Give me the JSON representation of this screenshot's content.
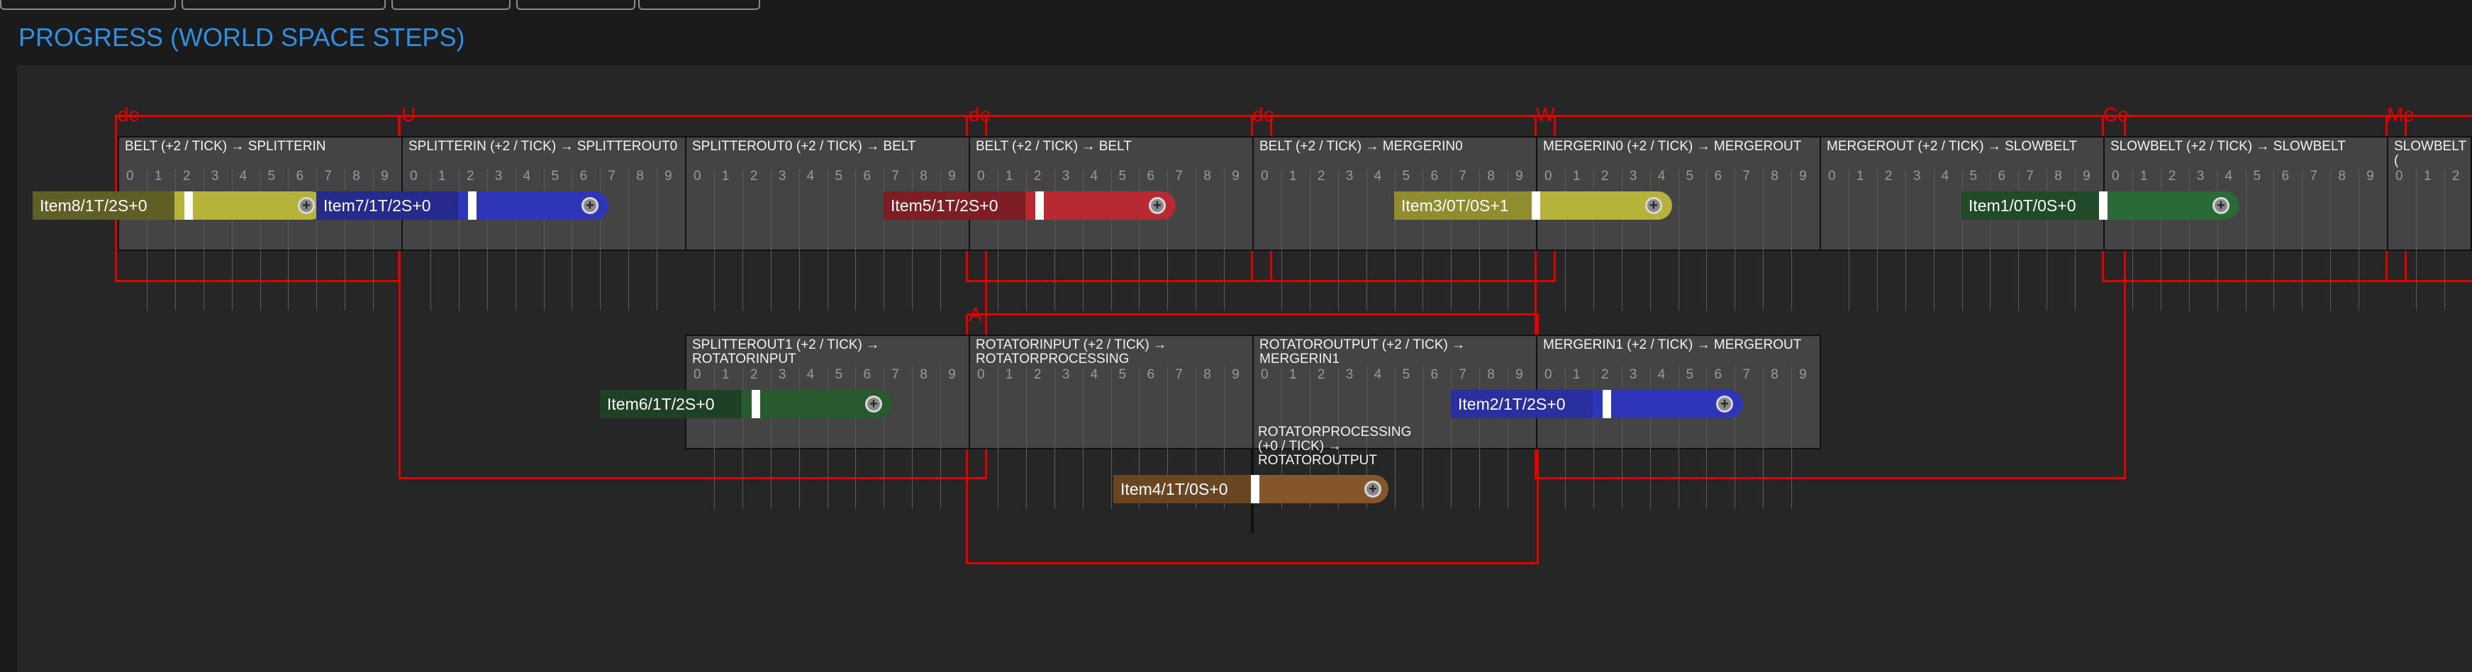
{
  "page": {
    "title": "PROGRESS (WORLD SPACE STEPS)"
  },
  "tick_labels": [
    "0",
    "1",
    "2",
    "3",
    "4",
    "5",
    "6",
    "7",
    "8",
    "9"
  ],
  "group_labels": {
    "g1": "de",
    "g2": "U",
    "g3": "de",
    "g4": "de",
    "g5": "W",
    "g6": "Ce",
    "g7": "Me",
    "g8": "A"
  },
  "segments": {
    "s1": "BELT (+2 / TICK) → SPLITTERIN",
    "s2": "SPLITTERIN (+2 / TICK) → SPLITTEROUT0",
    "s3": "SPLITTEROUT0 (+2 / TICK) → BELT",
    "s4": "BELT (+2 / TICK) → BELT",
    "s5": "BELT (+2 / TICK) → MERGERIN0",
    "s6": "MERGERIN0 (+2 / TICK) → MERGEROUT",
    "s7": "MERGEROUT (+2 / TICK) → SLOWBELT",
    "s8": "SLOWBELT (+2 / TICK) → SLOWBELT",
    "s9": "SLOWBELT (",
    "s10": "SPLITTEROUT1 (+2 / TICK) → ROTATORINPUT",
    "s11": "ROTATORINPUT (+2 / TICK) → ROTATORPROCESSING",
    "s12": "ROTATOROUTPUT (+2 / TICK) → MERGERIN1",
    "s13": "MERGERIN1 (+2 / TICK) → MERGEROUT",
    "s14": "ROTATORPROCESSING (+0 / TICK) → ROTATOROUTPUT"
  },
  "items": {
    "item8": {
      "label": "Item8/1T/2S+0",
      "color": "#b5b33a"
    },
    "item7": {
      "label": "Item7/1T/2S+0",
      "color": "#2f35b8"
    },
    "item5": {
      "label": "Item5/1T/2S+0",
      "color": "#b82a32"
    },
    "item3": {
      "label": "Item3/0T/0S+1",
      "color": "#b5b33a"
    },
    "item1": {
      "label": "Item1/0T/0S+0",
      "color": "#2a6a36"
    },
    "item6": {
      "label": "Item6/1T/2S+0",
      "color": "#275a2e"
    },
    "item2": {
      "label": "Item2/1T/2S+0",
      "color": "#2f35b8"
    },
    "item4": {
      "label": "Item4/1T/0S+0",
      "color": "#85562a"
    }
  },
  "cap_glyph": "+",
  "colors": {
    "title": "#2f8fe0",
    "group_border": "#e00000",
    "segment_bg": "#444444"
  }
}
